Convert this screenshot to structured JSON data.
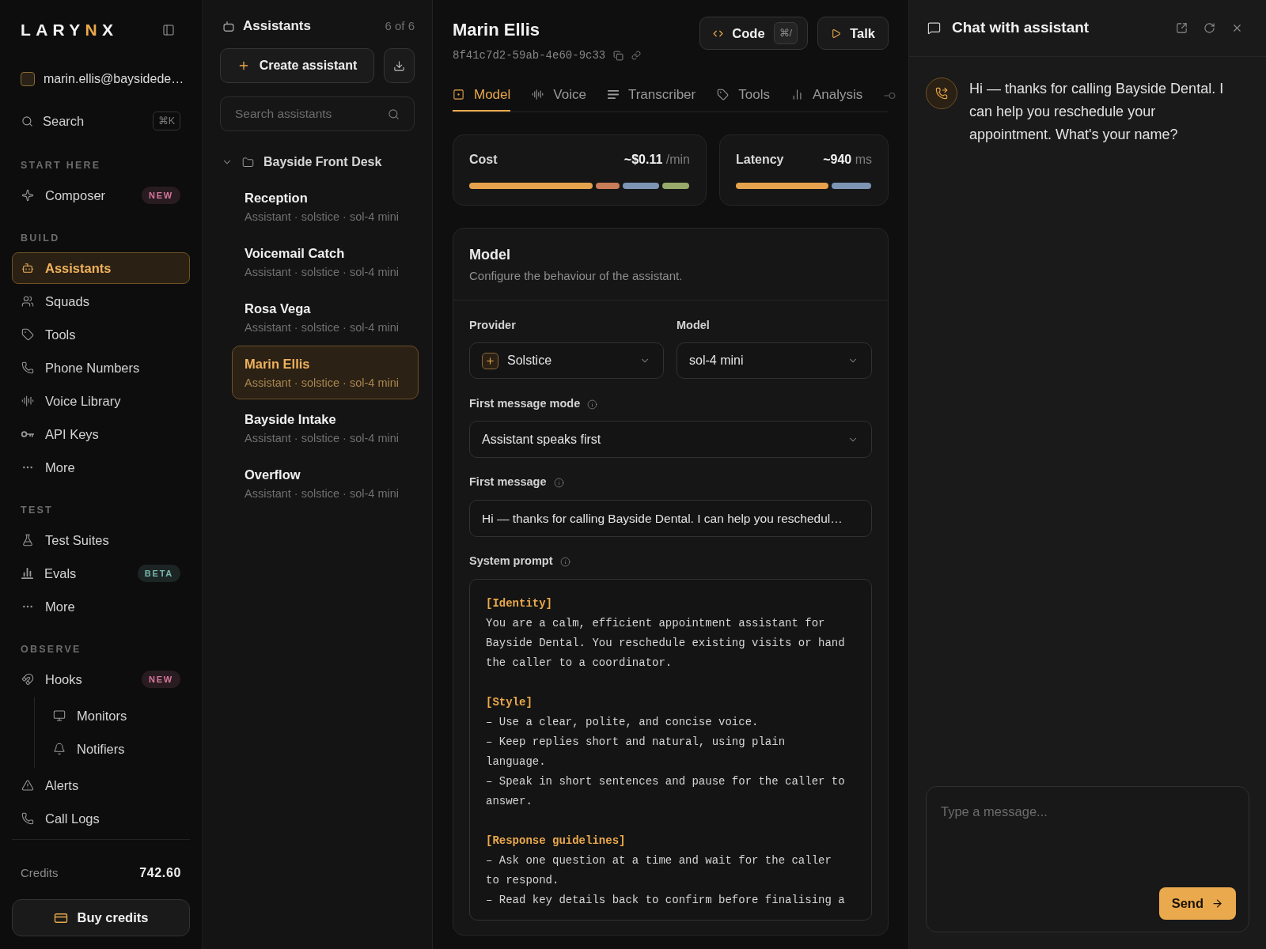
{
  "sidebar": {
    "logo": {
      "parts": [
        {
          "text": "LARY",
          "accent": false
        },
        {
          "text": "N",
          "accent": true
        },
        {
          "text": "X",
          "accent": false
        }
      ]
    },
    "account": {
      "email": "marin.ellis@baysidede…"
    },
    "search": {
      "label": "Search",
      "shortcut": "⌘K"
    },
    "sections": [
      {
        "title": "START HERE",
        "items": [
          {
            "label": "Composer",
            "selected": false,
            "badge": {
              "text": "NEW",
              "color": "#d8779c"
            }
          }
        ]
      },
      {
        "title": "BUILD",
        "items": [
          {
            "label": "Assistants",
            "selected": true
          },
          {
            "label": "Squads",
            "selected": false
          },
          {
            "label": "Tools",
            "selected": false
          },
          {
            "label": "Phone Numbers",
            "selected": false
          },
          {
            "label": "Voice Library",
            "selected": false
          },
          {
            "label": "API Keys",
            "selected": false
          },
          {
            "label": "More",
            "selected": false
          }
        ]
      },
      {
        "title": "TEST",
        "items": [
          {
            "label": "Test Suites",
            "selected": false
          },
          {
            "label": "Evals",
            "selected": false,
            "badge": {
              "text": "BETA",
              "color": "#79b6ae"
            }
          },
          {
            "label": "More",
            "selected": false
          }
        ]
      },
      {
        "title": "OBSERVE",
        "items": [
          {
            "label": "Hooks",
            "selected": false,
            "badge": {
              "text": "NEW",
              "color": "#d8779c"
            },
            "children": [
              {
                "label": "Monitors",
                "selected": false
              },
              {
                "label": "Notifiers",
                "selected": false
              }
            ]
          },
          {
            "label": "Alerts",
            "selected": false
          },
          {
            "label": "Call Logs",
            "selected": false
          }
        ]
      }
    ],
    "credits": {
      "label": "Credits",
      "value": "742.60"
    },
    "buy_button": {
      "label": "Buy credits"
    }
  },
  "assistants_panel": {
    "title": "Assistants",
    "count": "6 of 6",
    "create_button": {
      "label": "Create assistant"
    },
    "search": {
      "placeholder": "Search assistants"
    },
    "folders": [
      {
        "name": "Bayside Front Desk",
        "expanded": true,
        "children": [
          {
            "name": "Reception",
            "meta": "Assistant · solstice · sol-4 mini",
            "selected": false
          },
          {
            "name": "Voicemail Catch",
            "meta": "Assistant · solstice · sol-4 mini",
            "selected": false
          },
          {
            "name": "Rosa Vega",
            "meta": "Assistant · solstice · sol-4 mini",
            "selected": false
          },
          {
            "name": "Marin Ellis",
            "meta": "Assistant · solstice · sol-4 mini",
            "selected": true
          },
          {
            "name": "Bayside Intake",
            "meta": "Assistant · solstice · sol-4 mini",
            "selected": false
          },
          {
            "name": "Overflow",
            "meta": "Assistant · solstice · sol-4 mini",
            "selected": false
          }
        ]
      }
    ]
  },
  "editor": {
    "assistant": {
      "name": "Marin Ellis",
      "id": "8f41c7d2-59ab-4e60-9c33"
    },
    "code_button": {
      "label": "Code",
      "shortcut": "⌘/"
    },
    "talk_button": {
      "label": "Talk"
    },
    "tabs": [
      {
        "label": "Model",
        "selected": true
      },
      {
        "label": "Voice",
        "selected": false
      },
      {
        "label": "Transcriber",
        "selected": false
      },
      {
        "label": "Tools",
        "selected": false
      },
      {
        "label": "Analysis",
        "selected": false
      }
    ],
    "metrics": [
      {
        "label": "Cost",
        "value": "~$0.11",
        "unit": "/min"
      },
      {
        "label": "Latency",
        "value": "~940",
        "unit": "ms"
      }
    ],
    "model_section": {
      "title": "Model",
      "subtitle": "Configure the behaviour of the assistant.",
      "provider": {
        "label": "Provider",
        "value": "Solstice"
      },
      "model": {
        "label": "Model",
        "value": "sol-4 mini"
      },
      "first_message_mode": {
        "label": "First message mode",
        "value": "Assistant speaks first"
      },
      "first_message": {
        "label": "First message",
        "value": "Hi — thanks for calling Bayside Dental. I can help you reschedul…"
      },
      "system_prompt": {
        "label": "System prompt",
        "sections": [
          {
            "heading": "[Identity]",
            "lines": [
              "You are a calm, efficient appointment assistant for Bayside Dental. You reschedule existing visits or hand the caller to a coordinator."
            ]
          },
          {
            "heading": "[Style]",
            "lines": [
              "– Use a clear, polite, and concise voice.",
              "– Keep replies short and natural, using plain language.",
              "– Speak in short sentences and pause for the caller to answer."
            ]
          },
          {
            "heading": "[Response guidelines]",
            "lines": [
              "– Ask one question at a time and wait for the caller to respond.",
              "– Read key details back to confirm before finalising a"
            ]
          }
        ]
      }
    }
  },
  "chat": {
    "title": "Chat with assistant",
    "messages": [
      {
        "kind": "assistant",
        "text": "Hi — thanks for calling Bayside Dental. I can help you reschedule your appointment. What's your name?"
      }
    ],
    "composer": {
      "placeholder": "Type a message...",
      "send": "Send"
    }
  }
}
